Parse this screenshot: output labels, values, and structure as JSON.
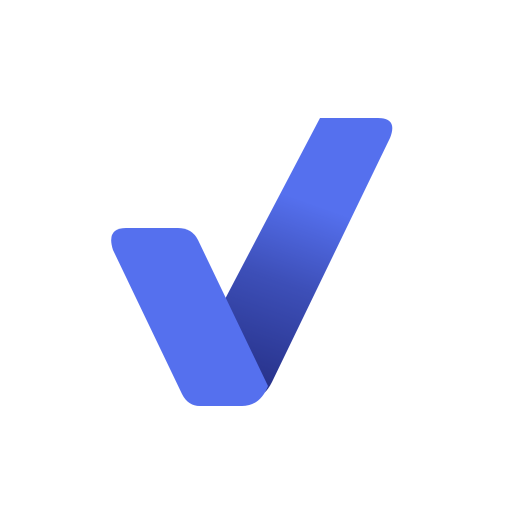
{
  "logo": {
    "icon": "checkmark-icon",
    "colors": {
      "background": "#ffffff",
      "primary": "#5570EE",
      "shadow_dark": "#28338C",
      "shadow_mid": "#3D4FB8"
    }
  }
}
